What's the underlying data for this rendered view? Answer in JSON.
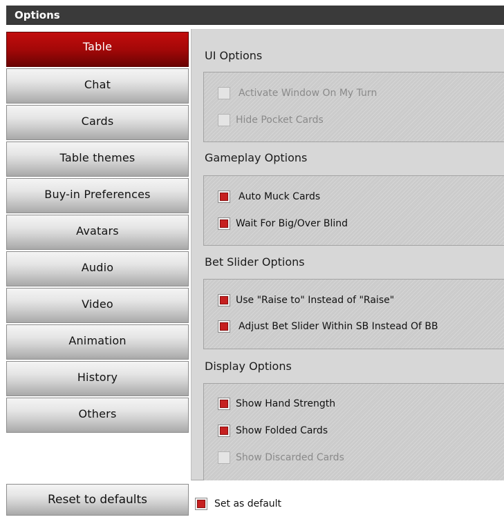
{
  "window": {
    "title": "Options"
  },
  "nav": {
    "items": [
      {
        "label": "Table",
        "active": true
      },
      {
        "label": "Chat"
      },
      {
        "label": "Cards"
      },
      {
        "label": "Table themes"
      },
      {
        "label": "Buy-in Preferences"
      },
      {
        "label": "Avatars"
      },
      {
        "label": "Audio"
      },
      {
        "label": "Video"
      },
      {
        "label": "Animation"
      },
      {
        "label": "History"
      },
      {
        "label": "Others"
      }
    ]
  },
  "sections": {
    "ui": {
      "title": "UI Options",
      "options": [
        {
          "label": "Activate Window On My Turn",
          "checked": false,
          "enabled": false
        },
        {
          "label": "Hide Pocket Cards",
          "checked": false,
          "enabled": false
        }
      ]
    },
    "gameplay": {
      "title": "Gameplay Options",
      "options": [
        {
          "label": "Auto Muck Cards",
          "checked": true,
          "enabled": true
        },
        {
          "label": "Wait For Big/Over Blind",
          "checked": true,
          "enabled": true
        }
      ]
    },
    "bet_slider": {
      "title": "Bet Slider Options",
      "options": [
        {
          "label": "Use \"Raise to\" Instead of \"Raise\"",
          "checked": true,
          "enabled": true
        },
        {
          "label": "Adjust Bet Slider Within SB Instead Of BB",
          "checked": true,
          "enabled": true
        }
      ]
    },
    "display": {
      "title": "Display Options",
      "options": [
        {
          "label": "Show Hand Strength",
          "checked": true,
          "enabled": true
        },
        {
          "label": "Show Folded Cards",
          "checked": true,
          "enabled": true
        },
        {
          "label": "Show Discarded Cards",
          "checked": false,
          "enabled": false
        }
      ]
    }
  },
  "footer": {
    "reset_label": "Reset to defaults",
    "set_default_label": "Set as default",
    "set_default_checked": true
  },
  "colors": {
    "accent_red": "#c62020",
    "title_bar": "#3a3a3a",
    "panel_bg": "#d7d7d7"
  }
}
